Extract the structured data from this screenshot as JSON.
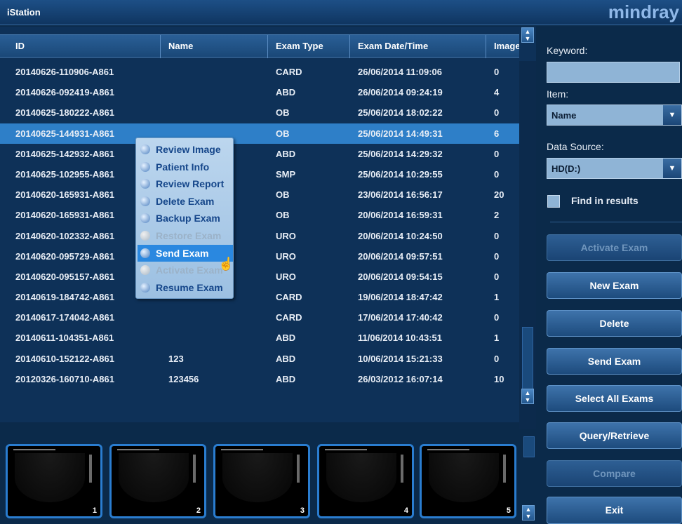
{
  "app": {
    "title": "iStation",
    "brand": "mindray"
  },
  "table": {
    "columns": [
      "ID",
      "Name",
      "Exam Type",
      "Exam Date/Time",
      "Image"
    ],
    "rows": [
      [
        "20140626-110906-A861",
        "",
        "CARD",
        "26/06/2014 11:09:06",
        "0"
      ],
      [
        "20140626-092419-A861",
        "",
        "ABD",
        "26/06/2014 09:24:19",
        "4"
      ],
      [
        "20140625-180222-A861",
        "",
        "OB",
        "25/06/2014 18:02:22",
        "0"
      ],
      [
        "20140625-144931-A861",
        "",
        "OB",
        "25/06/2014 14:49:31",
        "6"
      ],
      [
        "20140625-142932-A861",
        "",
        "ABD",
        "25/06/2014 14:29:32",
        "0"
      ],
      [
        "20140625-102955-A861",
        "",
        "SMP",
        "25/06/2014 10:29:55",
        "0"
      ],
      [
        "20140620-165931-A861",
        "",
        "OB",
        "23/06/2014 16:56:17",
        "20"
      ],
      [
        "20140620-165931-A861",
        "",
        "OB",
        "20/06/2014 16:59:31",
        "2"
      ],
      [
        "20140620-102332-A861",
        "",
        "URO",
        "20/06/2014 10:24:50",
        "0"
      ],
      [
        "20140620-095729-A861",
        "",
        "URO",
        "20/06/2014 09:57:51",
        "0"
      ],
      [
        "20140620-095157-A861",
        "",
        "URO",
        "20/06/2014 09:54:15",
        "0"
      ],
      [
        "20140619-184742-A861",
        "",
        "CARD",
        "19/06/2014 18:47:42",
        "1"
      ],
      [
        "20140617-174042-A861",
        "",
        "CARD",
        "17/06/2014 17:40:42",
        "0"
      ],
      [
        "20140611-104351-A861",
        "",
        "ABD",
        "11/06/2014 10:43:51",
        "1"
      ],
      [
        "20140610-152122-A861",
        "123",
        "ABD",
        "10/06/2014 15:21:33",
        "0"
      ],
      [
        "20120326-160710-A861",
        "123456",
        "ABD",
        "26/03/2012 16:07:14",
        "10"
      ]
    ],
    "selected_row": 3
  },
  "context_menu": {
    "items": [
      {
        "label": "Review Image",
        "enabled": true,
        "highlighted": false,
        "icon": "review-image-icon"
      },
      {
        "label": "Patient Info",
        "enabled": true,
        "highlighted": false,
        "icon": "patient-info-icon"
      },
      {
        "label": "Review Report",
        "enabled": true,
        "highlighted": false,
        "icon": "review-report-icon"
      },
      {
        "label": "Delete Exam",
        "enabled": true,
        "highlighted": false,
        "icon": "delete-exam-icon"
      },
      {
        "label": "Backup Exam",
        "enabled": true,
        "highlighted": false,
        "icon": "backup-exam-icon"
      },
      {
        "label": "Restore Exam",
        "enabled": false,
        "highlighted": false,
        "icon": "restore-exam-icon"
      },
      {
        "label": "Send Exam",
        "enabled": true,
        "highlighted": true,
        "icon": "send-exam-icon"
      },
      {
        "label": "Activate Exam",
        "enabled": false,
        "highlighted": false,
        "icon": "activate-exam-icon"
      },
      {
        "label": "Resume Exam",
        "enabled": true,
        "highlighted": false,
        "icon": "resume-exam-icon"
      }
    ]
  },
  "thumbnails": [
    "1",
    "2",
    "3",
    "4",
    "5"
  ],
  "sidebar": {
    "keyword_label": "Keyword:",
    "keyword_value": "",
    "item_label": "Item:",
    "item_value": "Name",
    "data_source_label": "Data Source:",
    "data_source_value": "HD(D:)",
    "find_in_results": "Find in results",
    "buttons": [
      {
        "label": "Activate Exam",
        "enabled": false
      },
      {
        "label": "New Exam",
        "enabled": true
      },
      {
        "label": "Delete",
        "enabled": true
      },
      {
        "label": "Send Exam",
        "enabled": true
      },
      {
        "label": "Select All Exams",
        "enabled": true
      },
      {
        "label": "Query/Retrieve",
        "enabled": true
      },
      {
        "label": "Compare",
        "enabled": false
      },
      {
        "label": "Exit",
        "enabled": true
      }
    ]
  },
  "colors": {
    "accent": "#2e7fc8",
    "background": "#0b2a4a",
    "menu_highlight": "#2a88e0"
  }
}
